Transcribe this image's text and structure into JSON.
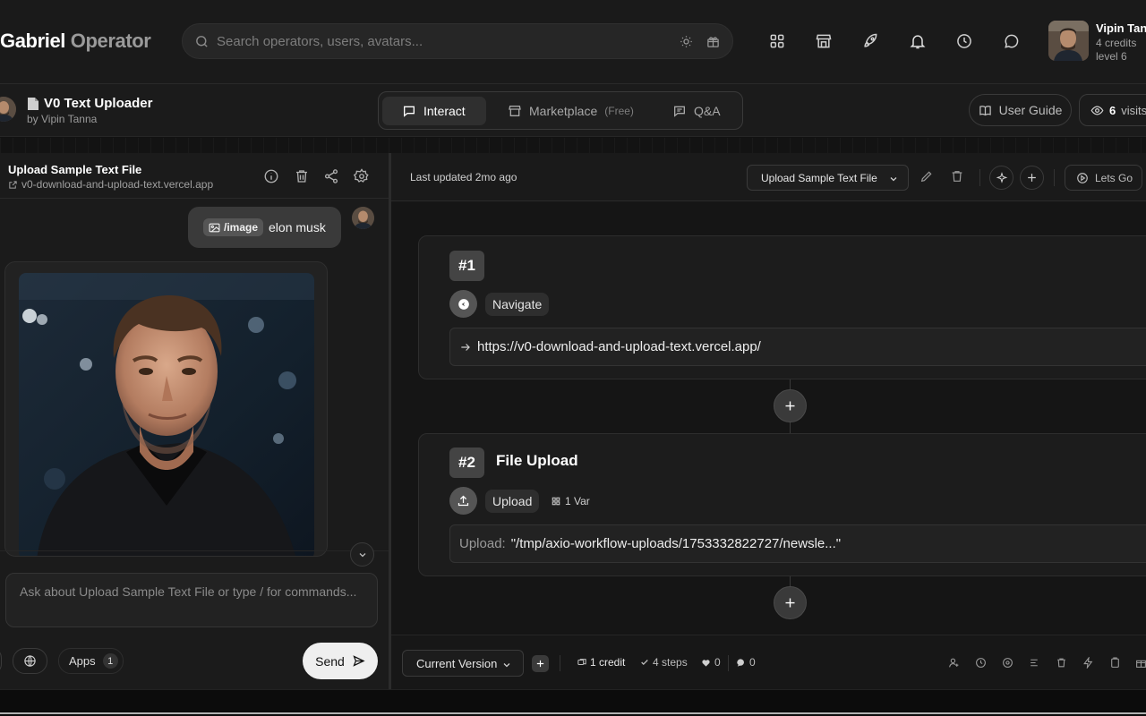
{
  "app": {
    "brand_part1": "Gabriel",
    "brand_part2": "Operator"
  },
  "search": {
    "placeholder": "Search operators, users, avatars..."
  },
  "profile": {
    "name": "Vipin Tanna",
    "credits": "4 credits",
    "level": "level 6"
  },
  "operator": {
    "title": "V0 Text Uploader",
    "author": "by Vipin Tanna"
  },
  "tabs": [
    {
      "label": "Interact",
      "suffix": ""
    },
    {
      "label": "Marketplace",
      "suffix": "(Free)"
    },
    {
      "label": "Q&A",
      "suffix": ""
    }
  ],
  "header_actions": {
    "user_guide": "User Guide",
    "visits_count": "6",
    "visits_label": "visits"
  },
  "chat": {
    "title": "Upload Sample Text File",
    "url": "v0-download-and-upload-text.vercel.app",
    "message_chip": "/image",
    "message_text": "elon musk",
    "input_placeholder": "Ask about Upload Sample Text File or type / for commands...",
    "apps_label": "Apps",
    "apps_count": "1",
    "send_label": "Send"
  },
  "workflow": {
    "last_updated": "Last updated 2mo ago",
    "selected_step": "Upload Sample Text File",
    "lets_go": "Lets Go",
    "steps": [
      {
        "number": "#1",
        "title": "",
        "action": "Navigate",
        "field_label": "",
        "field_value": "https://v0-download-and-upload-text.vercel.app/"
      },
      {
        "number": "#2",
        "title": "File Upload",
        "action": "Upload",
        "var_label": "1 Var",
        "field_label": "Upload:",
        "field_value": "\"/tmp/axio-workflow-uploads/1753332822727/newsle...\""
      }
    ]
  },
  "footer": {
    "version": "Current Version",
    "credits": "1 credit",
    "steps": "4 steps",
    "likes": "0",
    "comments": "0"
  },
  "icons": {
    "accent_color": "#efefef",
    "step_badge_color": "#444444"
  }
}
